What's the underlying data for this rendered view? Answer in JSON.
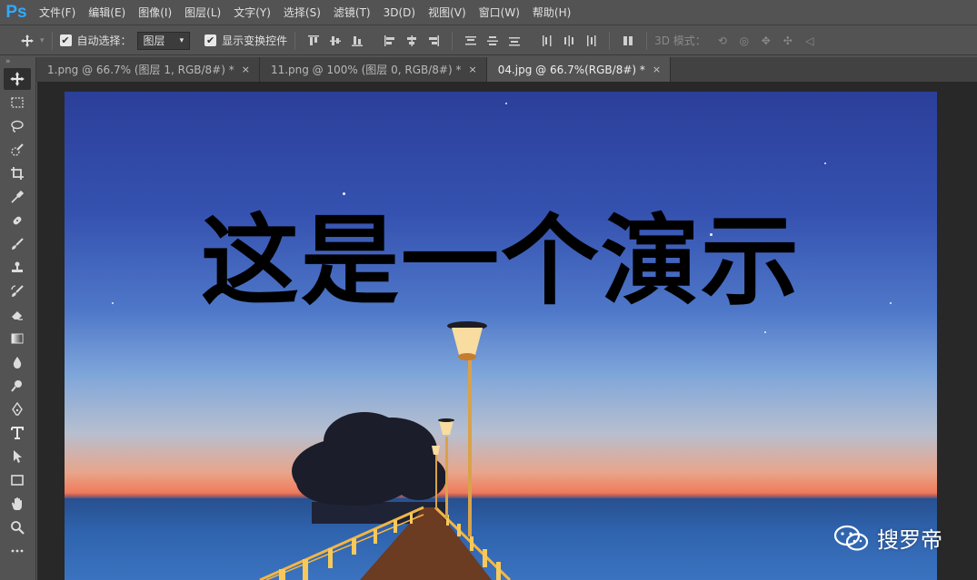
{
  "app": {
    "logo": "Ps"
  },
  "menu": [
    {
      "label": "文件(F)"
    },
    {
      "label": "编辑(E)"
    },
    {
      "label": "图像(I)"
    },
    {
      "label": "图层(L)"
    },
    {
      "label": "文字(Y)"
    },
    {
      "label": "选择(S)"
    },
    {
      "label": "滤镜(T)"
    },
    {
      "label": "3D(D)"
    },
    {
      "label": "视图(V)"
    },
    {
      "label": "窗口(W)"
    },
    {
      "label": "帮助(H)"
    }
  ],
  "options": {
    "auto_select_label": "自动选择：",
    "auto_select_checked": true,
    "layer_select_value": "图层",
    "show_transform_label": "显示变换控件",
    "show_transform_checked": true,
    "mode_3d_label": "3D 模式："
  },
  "tabs": [
    {
      "label": "1.png @ 66.7% (图层 1, RGB/8#) *",
      "close": "×",
      "active": false
    },
    {
      "label": "11.png @ 100% (图层 0, RGB/8#) *",
      "close": "×",
      "active": false
    },
    {
      "label": "04.jpg @ 66.7%(RGB/8#) *",
      "close": "×",
      "active": true
    }
  ],
  "tools": [
    "move-tool",
    "marquee-tool",
    "lasso-tool",
    "quick-select-tool",
    "crop-tool",
    "eyedropper-tool",
    "healing-brush-tool",
    "brush-tool",
    "clone-stamp-tool",
    "history-brush-tool",
    "eraser-tool",
    "gradient-tool",
    "blur-tool",
    "dodge-tool",
    "pen-tool",
    "type-tool",
    "path-select-tool",
    "rectangle-tool",
    "hand-tool",
    "zoom-tool",
    "more-tools"
  ],
  "canvas": {
    "headline": "这是一个演示",
    "watermark": "搜罗帝"
  },
  "colors": {
    "ui_bg": "#535353",
    "accent_logo": "#31a8ff",
    "headline": "#000000"
  }
}
